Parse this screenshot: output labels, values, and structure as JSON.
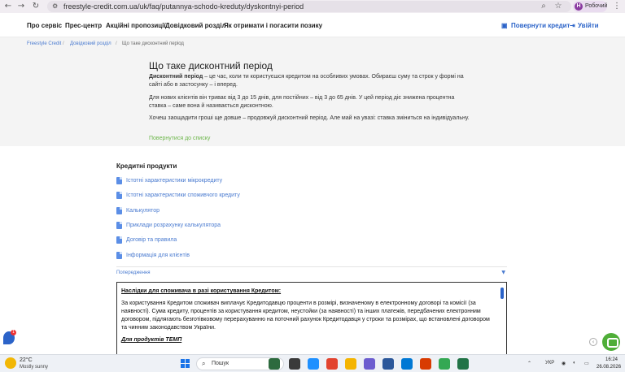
{
  "browser": {
    "url": "freestyle-credit.com.ua/uk/faq/putannya-schodo-kreduty/dyskontnyi-period",
    "profile_initial": "Н",
    "profile_label": "Робочий"
  },
  "site_nav": {
    "items": [
      "Про сервіс",
      "Прес-центр",
      "Акційні пропозиції",
      "Довідковий розділ",
      "Як отримати і погасити позику"
    ],
    "return_credit": "Повернути кредит",
    "login": "Увійти"
  },
  "breadcrumb": [
    "Freestyle Credit",
    "Довідковий розділ",
    "Що таке дисконтний період"
  ],
  "article": {
    "title": "Що таке дисконтний період",
    "p1_bold": "Дисконтний період",
    "p1_rest": " – це час, коли ти користуєшся кредитом на особливих умовах. Обираєш суму та строк у формі на сайті або в застосунку – і вперед.",
    "p2": "Для нових клієнтів він триває від 3 до 15 днів, для постійних – від 3 до 65 днів. У цей період діє знижена процентна ставка – саме вона й називається дисконтною.",
    "p3": "Хочеш заощадити гроші ще довше – продовжуй дисконтний період. Але май на увазі: ставка зміниться на індивідуальну.",
    "back_link": "Повернутися до списку"
  },
  "products": {
    "title": "Кредитні продукти",
    "items": [
      "Істотні характеристики мікрокредиту",
      "Істотні характеристики споживчого кредиту",
      "Калькулятор",
      "Приклади розрахунку калькулятора",
      "Договір та правила",
      "Інформація для клієнтів"
    ]
  },
  "warning": {
    "label": "Попередження",
    "heading": "Наслідки для споживача в разі користування Кредитом:",
    "body": "За користування Кредитом споживач виплачує Кредитодавцю проценти в розмірі, визначеному в електронному договорі та комісії (за наявності). Сума кредиту, процентів за користування кредитом, неустойки (за наявності) та інших платежів, передбачених електронним договором, підлягають безготівковому перерахуванню на поточний рахунок Кредитодавця у строки та розмірах, що встановлені договором та чинним законодавством України.",
    "subheading": "Для продуктів ТЕМП"
  },
  "taskbar": {
    "temp": "22°C",
    "weather": "Mostly sunny",
    "search": "Пошук",
    "lang": "УКР",
    "time": "16:24",
    "date": "26.08.2026"
  },
  "colors": {
    "link": "#4a7bd0",
    "accent_green": "#6cb64a",
    "brand_blue": "#2b63c8"
  }
}
